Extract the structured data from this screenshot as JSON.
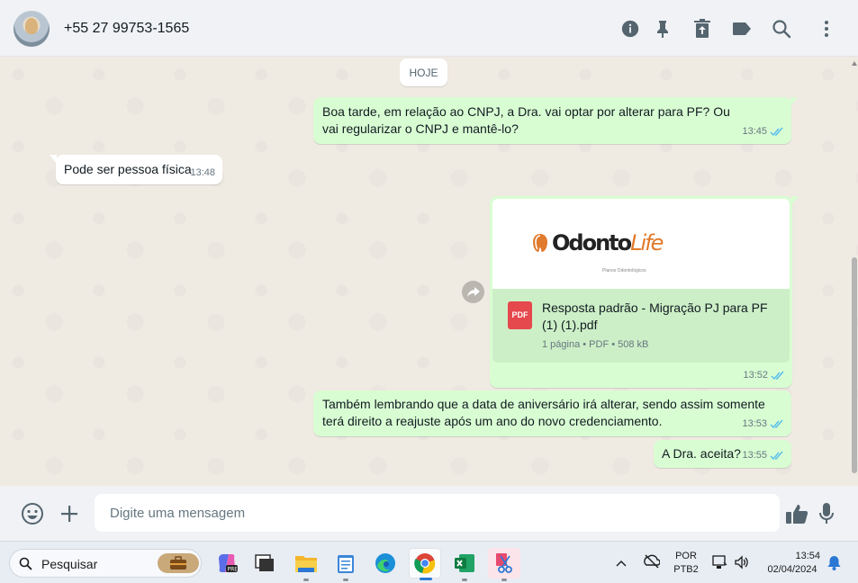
{
  "header": {
    "contact_name": "+55 27 99753-1565",
    "icons": [
      "info-icon",
      "pin-icon",
      "delete-icon",
      "label-icon",
      "search-icon",
      "menu-icon"
    ]
  },
  "chat": {
    "date_chip": "HOJE",
    "messages": [
      {
        "direction": "out",
        "text": "Boa tarde, em relação ao CNPJ, a Dra. vai optar por alterar para PF? Ou vai regularizar o CNPJ e mantê-lo?",
        "time": "13:45"
      },
      {
        "direction": "in",
        "text": "Pode ser pessoa física",
        "time": "13:48"
      },
      {
        "direction": "out",
        "type": "document",
        "logo_main": "Odonto",
        "logo_accent": "Life",
        "logo_tagline": "Planos Odontológicos",
        "icon_label": "PDF",
        "file_name": "Resposta padrão - Migração PJ para PF (1) (1).pdf",
        "file_meta": "1 página • PDF • 508 kB",
        "time": "13:52"
      },
      {
        "direction": "out",
        "text": "Também lembrando que a data de aniversário irá alterar, sendo assim somente terá direito a reajuste após um ano do novo credenciamento.",
        "time": "13:53"
      },
      {
        "direction": "out",
        "text": "A Dra. aceita?",
        "time": "13:55"
      }
    ]
  },
  "composer": {
    "placeholder": "Digite uma mensagem"
  },
  "taskbar": {
    "search_label": "Pesquisar",
    "language": "POR",
    "keyboard": "PTB2",
    "time": "13:54",
    "date": "02/04/2024"
  },
  "colors": {
    "outgoing_bubble": "#d9fdd3",
    "incoming_bubble": "#ffffff",
    "read_ticks": "#53bdeb",
    "chat_bg": "#efeae2"
  }
}
